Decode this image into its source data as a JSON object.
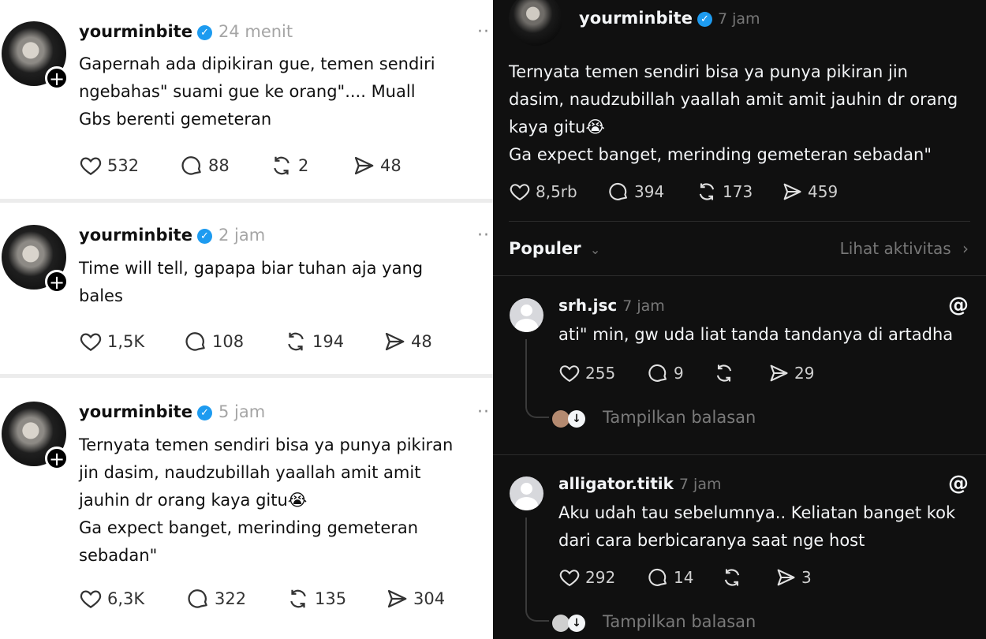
{
  "left_posts": [
    {
      "username": "yourminbite",
      "time": "24 menit",
      "text": "Gapernah ada dipikiran gue, temen sendiri\nngebahas\" suami gue ke orang\".... Muall\nGbs berenti gemeteran",
      "likes": "532",
      "comments": "88",
      "reposts": "2",
      "shares": "48"
    },
    {
      "username": "yourminbite",
      "time": "2 jam",
      "text": "Time will tell, gapapa biar tuhan aja yang\nbales",
      "likes": "1,5K",
      "comments": "108",
      "reposts": "194",
      "shares": "48"
    },
    {
      "username": "yourminbite",
      "time": "5 jam",
      "text": "Ternyata temen sendiri bisa ya punya pikiran\njin dasim, naudzubillah yaallah amit amit\njauhin dr orang kaya gitu😭\nGa expect banget, merinding gemeteran\nsebadan\"",
      "likes": "6,3K",
      "comments": "322",
      "reposts": "135",
      "shares": "304"
    }
  ],
  "right_post": {
    "username": "yourminbite",
    "time": "7 jam",
    "text": "Ternyata temen sendiri bisa ya punya pikiran jin\ndasim, naudzubillah yaallah amit amit jauhin dr orang\nkaya gitu😭\nGa expect banget, merinding gemeteran sebadan\"",
    "likes": "8,5rb",
    "comments": "394",
    "reposts": "173",
    "shares": "459"
  },
  "replies_header": {
    "sort_label": "Populer",
    "activity_link": "Lihat aktivitas"
  },
  "replies": [
    {
      "username": "srh.jsc",
      "time": "7 jam",
      "text": "ati\" min, gw uda liat tanda tandanya di artadha",
      "likes": "255",
      "comments": "9",
      "reposts": "",
      "shares": "29",
      "show_replies": "Tampilkan balasan"
    },
    {
      "username": "alligator.titik",
      "time": "7 jam",
      "text": "Aku udah tau sebelumnya.. Keliatan banget kok\ndari cara berbicaranya saat nge host",
      "likes": "292",
      "comments": "14",
      "reposts": "",
      "shares": "3",
      "show_replies": "Tampilkan balasan"
    }
  ],
  "colors": {
    "verified": "#1d9bf0",
    "dark_bg": "#101010",
    "light_bg": "#ffffff"
  }
}
